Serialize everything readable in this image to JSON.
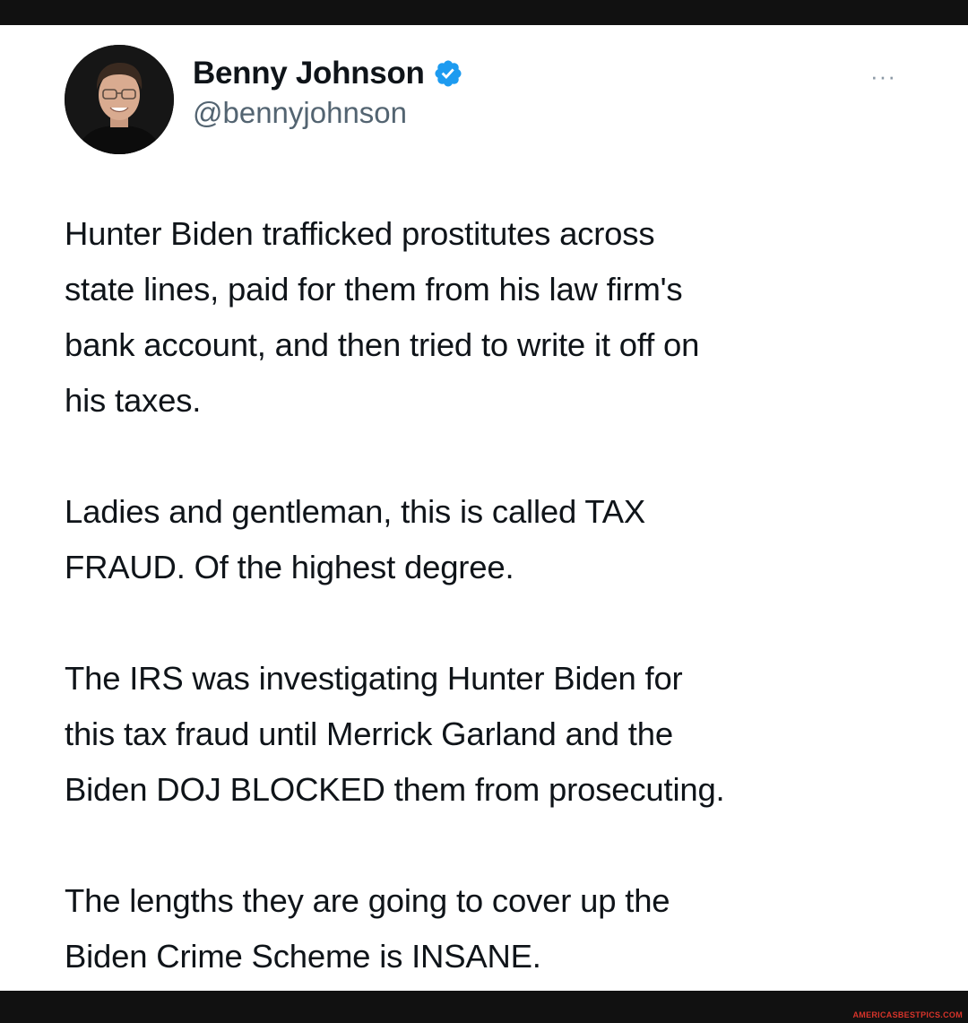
{
  "author": {
    "display_name": "Benny Johnson",
    "handle": "@bennyjohnson",
    "verified": true,
    "verified_color": "#1d9bf0"
  },
  "menu": {
    "more_label": "···"
  },
  "tweet": {
    "paragraphs": [
      "Hunter Biden trafficked prostitutes across\nstate lines, paid for them from his law firm's\nbank account, and then tried to write it off on\nhis taxes.",
      "Ladies and gentleman, this is called TAX\nFRAUD. Of the highest degree.",
      "The IRS was investigating Hunter Biden for\nthis tax fraud until Merrick Garland and the\nBiden DOJ BLOCKED them from prosecuting.",
      "The lengths they are going to cover up the\nBiden Crime Scheme is INSANE."
    ]
  },
  "watermark": "AMERICASBESTPICS.COM"
}
